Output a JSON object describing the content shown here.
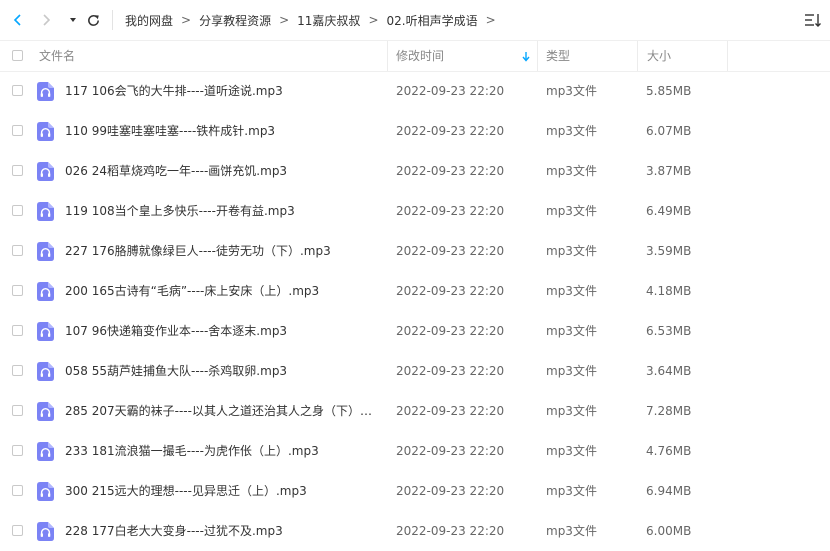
{
  "nav": {
    "breadcrumbs": [
      "我的网盘",
      "分享教程资源",
      "11嘉庆叔叔",
      "02.听相声学成语"
    ],
    "separator": ">"
  },
  "columns": {
    "name": "文件名",
    "modified": "修改时间",
    "type": "类型",
    "size": "大小"
  },
  "files": [
    {
      "name": "117 106会飞的大牛排----道听途说.mp3",
      "modified": "2022-09-23 22:20",
      "type": "mp3文件",
      "size": "5.85MB"
    },
    {
      "name": "110 99哇塞哇塞哇塞----铁杵成针.mp3",
      "modified": "2022-09-23 22:20",
      "type": "mp3文件",
      "size": "6.07MB"
    },
    {
      "name": "026 24稻草烧鸡吃一年----画饼充饥.mp3",
      "modified": "2022-09-23 22:20",
      "type": "mp3文件",
      "size": "3.87MB"
    },
    {
      "name": "119 108当个皇上多快乐----开卷有益.mp3",
      "modified": "2022-09-23 22:20",
      "type": "mp3文件",
      "size": "6.49MB"
    },
    {
      "name": "227 176胳膊就像绿巨人----徒劳无功（下）.mp3",
      "modified": "2022-09-23 22:20",
      "type": "mp3文件",
      "size": "3.59MB"
    },
    {
      "name": "200 165古诗有“毛病”----床上安床（上）.mp3",
      "modified": "2022-09-23 22:20",
      "type": "mp3文件",
      "size": "4.18MB"
    },
    {
      "name": "107 96快递箱变作业本----舍本逐末.mp3",
      "modified": "2022-09-23 22:20",
      "type": "mp3文件",
      "size": "6.53MB"
    },
    {
      "name": "058 55葫芦娃捕鱼大队----杀鸡取卵.mp3",
      "modified": "2022-09-23 22:20",
      "type": "mp3文件",
      "size": "3.64MB"
    },
    {
      "name": "285 207天霸的袜子----以其人之道还治其人之身（下）....",
      "modified": "2022-09-23 22:20",
      "type": "mp3文件",
      "size": "7.28MB"
    },
    {
      "name": "233 181流浪猫一撮毛----为虎作伥（上）.mp3",
      "modified": "2022-09-23 22:20",
      "type": "mp3文件",
      "size": "4.76MB"
    },
    {
      "name": "300 215远大的理想----见异思迁（上）.mp3",
      "modified": "2022-09-23 22:20",
      "type": "mp3文件",
      "size": "6.94MB"
    },
    {
      "name": "228 177白老大大变身----过犹不及.mp3",
      "modified": "2022-09-23 22:20",
      "type": "mp3文件",
      "size": "6.00MB"
    }
  ],
  "icons": {
    "back": "chevron-left-icon",
    "forward": "chevron-right-icon",
    "history": "caret-down-icon",
    "refresh": "refresh-icon",
    "sort": "sort-order-icon",
    "file": "audio-file-icon",
    "sort_indicator": "arrow-down-icon"
  },
  "colors": {
    "accent": "#06a7ff",
    "file_icon": "#7b83f5",
    "disabled": "#c8c8c8"
  }
}
